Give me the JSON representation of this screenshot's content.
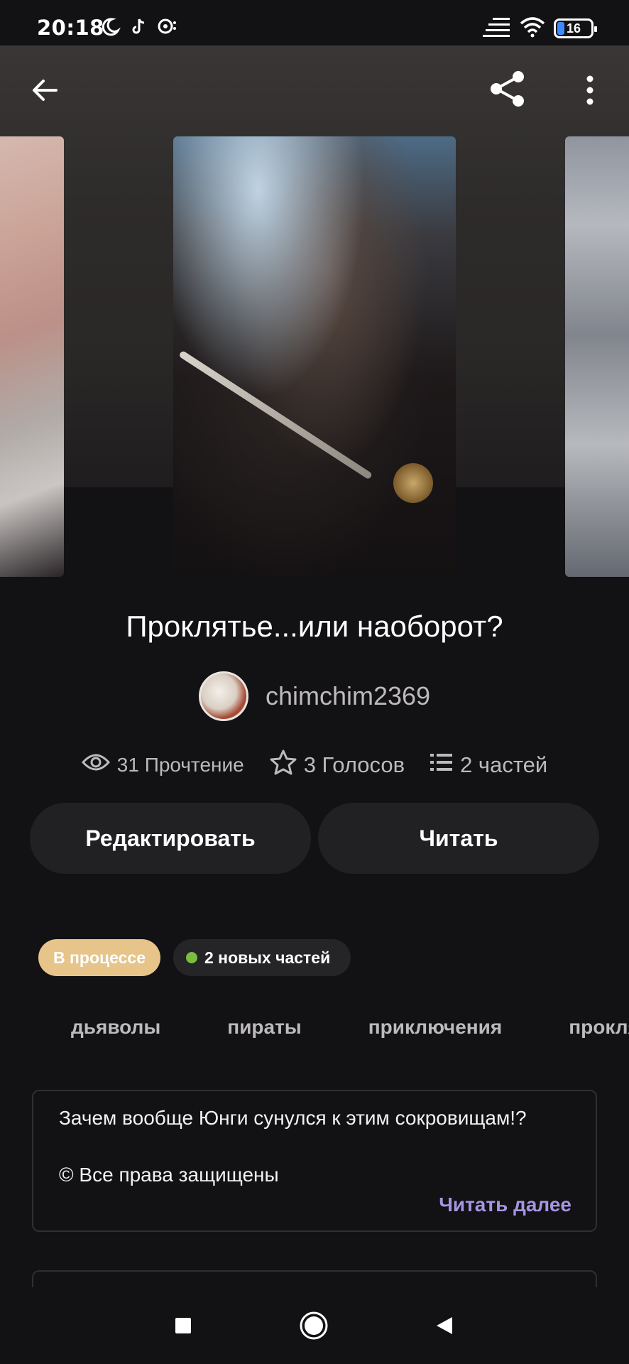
{
  "status_bar": {
    "time": "20:18",
    "battery": "16",
    "icons": [
      "moon-icon",
      "tiktok-icon",
      "chat-bubble-icon",
      "signal-icon",
      "wifi-icon",
      "battery-icon"
    ]
  },
  "top_actions": {
    "icons": [
      "back-arrow-icon",
      "share-icon",
      "more-vertical-icon"
    ]
  },
  "story": {
    "title": "Проклятье...или наоборот?",
    "author": "chimchim2369",
    "stats": {
      "reads": "31 Прочтение",
      "votes": "3 Голосов",
      "parts": "2 частей"
    }
  },
  "actions": {
    "edit_label": "Редактировать",
    "read_label": "Читать"
  },
  "chips": {
    "status": "В процессе",
    "new_parts": "2 новых частей"
  },
  "tags": [
    "дьяволы",
    "пираты",
    "приключения",
    "проклятье"
  ],
  "description": {
    "text": "Зачем вообще Юнги сунулся к этим сокровищам!?",
    "copyright": "© Все права защищены",
    "read_more": "Читать далее"
  },
  "colors": {
    "background": "#121113",
    "status_chip": "#e6c48a",
    "new_dot": "#7bbd3f",
    "read_more": "#a695e3",
    "button": "#212022"
  },
  "nav_bar": {
    "icons": [
      "recent-apps-icon",
      "home-icon",
      "back-icon"
    ]
  }
}
